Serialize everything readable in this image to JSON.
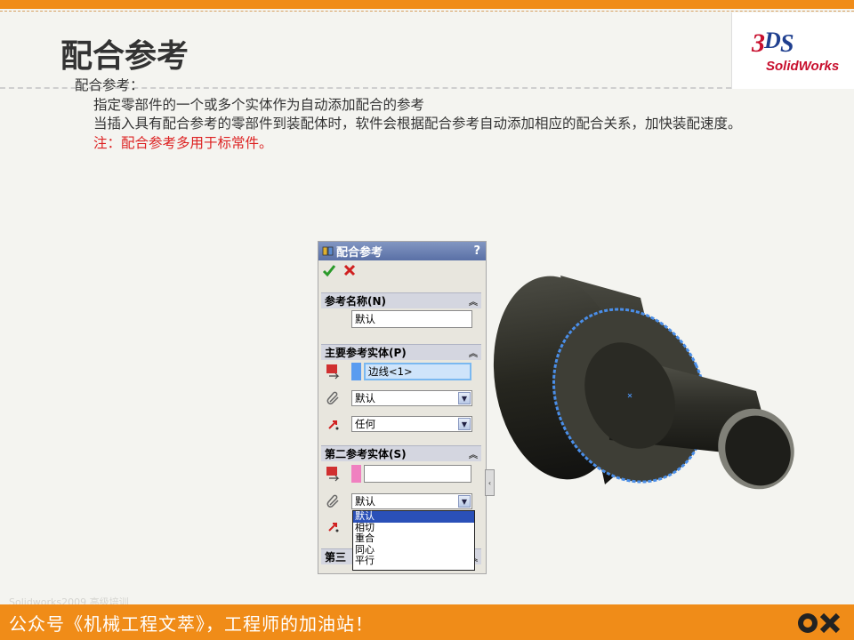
{
  "slide": {
    "title": "配合参考",
    "watermark": "Solidworks2009 高级培训",
    "footer": "公众号《机械工程文萃》，工程师的加油站！"
  },
  "logo": {
    "text": "SolidWorks"
  },
  "content": {
    "heading": "配合参考：",
    "line1": "指定零部件的一个或多个实体作为自动添加配合的参考",
    "line2": "当插入具有配合参考的零部件到装配体时，软件会根据配合参考自动添加相应的配合关系，加快装配速度。",
    "note": "注：配合参考多用于标常件。"
  },
  "panel": {
    "title": "配合参考",
    "help": "?",
    "ok_icon": "checkmark-icon",
    "cancel_icon": "cross-icon",
    "ref_name": {
      "label": "参考名称(N)",
      "value": "默认"
    },
    "primary": {
      "label": "主要参考实体(P)",
      "entity_value": "边线<1>",
      "mate_type": "默认",
      "alignment": "任何",
      "entity_color": "#5a9cf0"
    },
    "secondary": {
      "label": "第二参考实体(S)",
      "entity_value": "",
      "mate_type": "默认",
      "entity_color": "#f080c0"
    },
    "third_label_partial": "第三",
    "dropdown_options": [
      "默认",
      "相切",
      "重合",
      "同心",
      "平行"
    ],
    "dropdown_selected": "默认"
  },
  "colors": {
    "accent": "#f08c18",
    "note_red": "#d22222",
    "selection_blue": "#2a50b8"
  }
}
